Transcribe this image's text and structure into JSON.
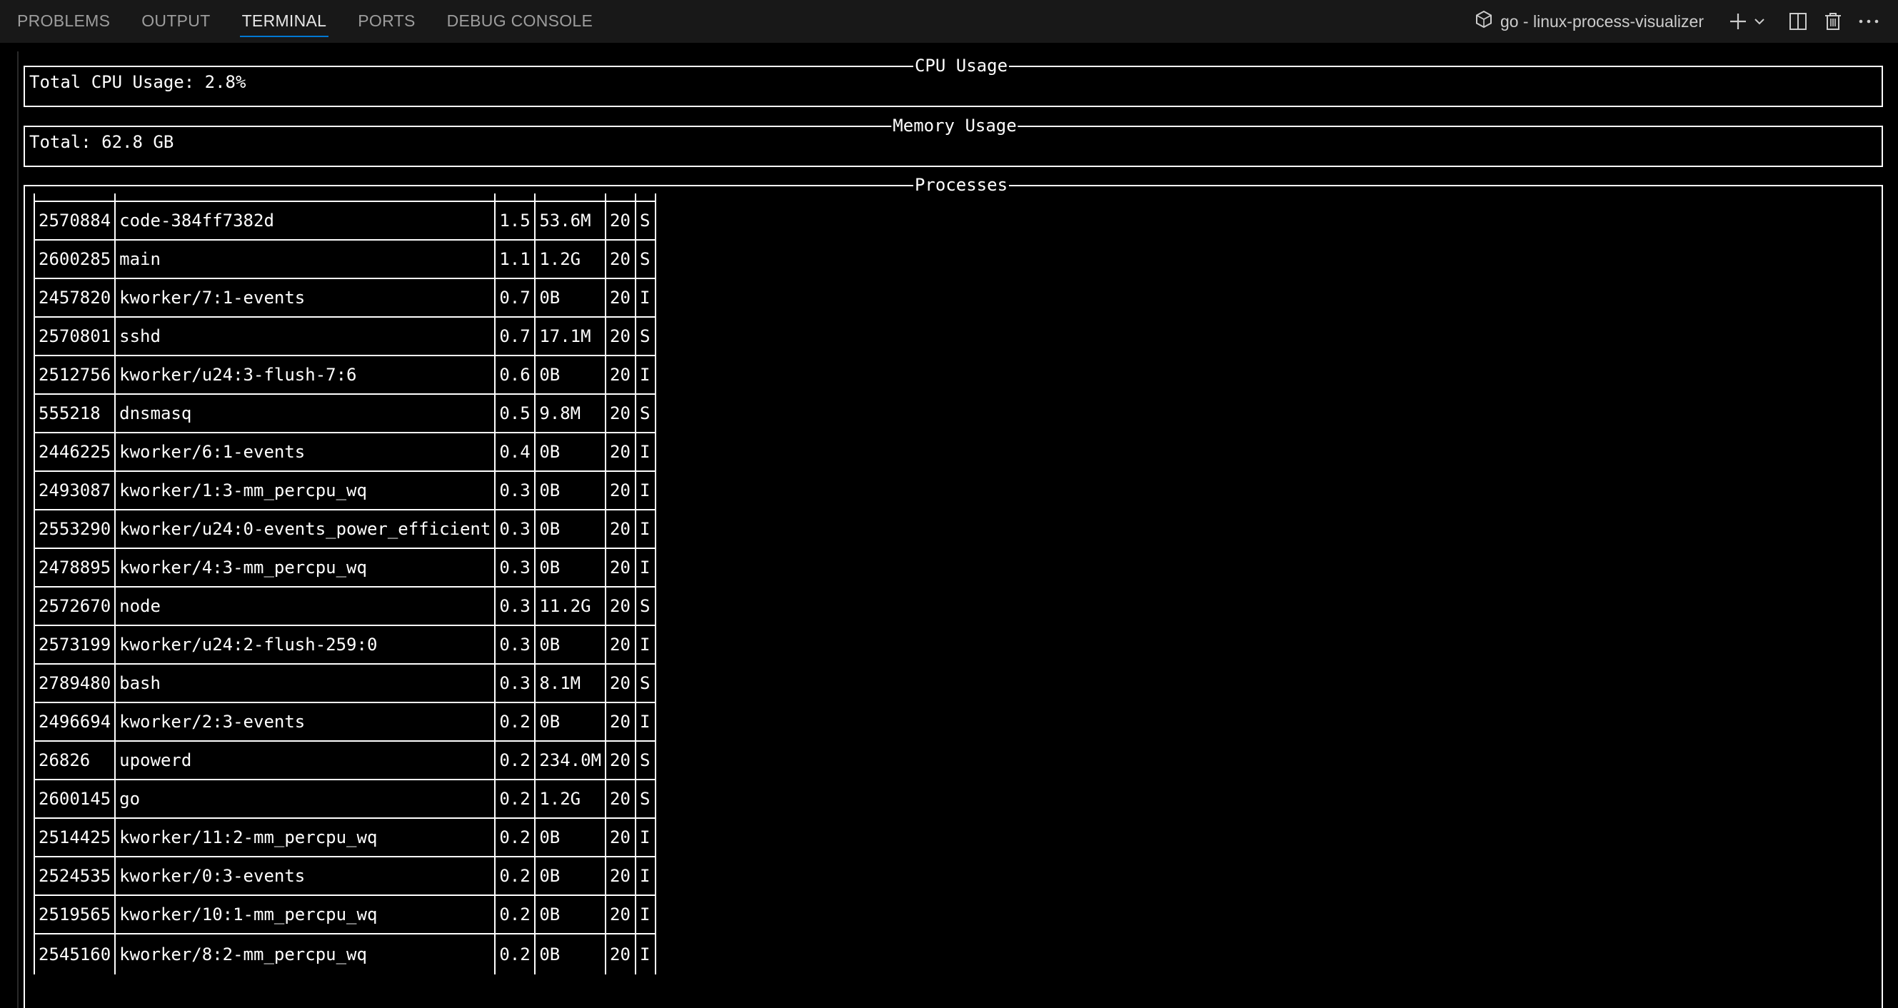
{
  "panel": {
    "tabs": [
      {
        "label": "PROBLEMS",
        "active": false
      },
      {
        "label": "OUTPUT",
        "active": false
      },
      {
        "label": "TERMINAL",
        "active": true
      },
      {
        "label": "PORTS",
        "active": false
      },
      {
        "label": "DEBUG CONSOLE",
        "active": false
      }
    ],
    "terminal_name": "go - linux-process-visualizer",
    "icons": [
      "terminal-icon",
      "plus-icon",
      "chevron-down-icon",
      "split-icon",
      "trash-icon",
      "more-icon"
    ],
    "accent_color": "#0078d4"
  },
  "cpu": {
    "title": "CPU Usage",
    "text": "Total CPU Usage: 2.8%"
  },
  "memory": {
    "title": "Memory Usage",
    "text": "Total: 62.8 GB"
  },
  "processes": {
    "title": "Processes",
    "rows": [
      [
        "2570884",
        "code-384ff7382d",
        "1.5",
        "53.6M",
        "20",
        "S"
      ],
      [
        "2600285",
        "main",
        "1.1",
        "1.2G",
        "20",
        "S"
      ],
      [
        "2457820",
        "kworker/7:1-events",
        "0.7",
        "0B",
        "20",
        "I"
      ],
      [
        "2570801",
        "sshd",
        "0.7",
        "17.1M",
        "20",
        "S"
      ],
      [
        "2512756",
        "kworker/u24:3-flush-7:6",
        "0.6",
        "0B",
        "20",
        "I"
      ],
      [
        "555218",
        "dnsmasq",
        "0.5",
        "9.8M",
        "20",
        "S"
      ],
      [
        "2446225",
        "kworker/6:1-events",
        "0.4",
        "0B",
        "20",
        "I"
      ],
      [
        "2493087",
        "kworker/1:3-mm_percpu_wq",
        "0.3",
        "0B",
        "20",
        "I"
      ],
      [
        "2553290",
        "kworker/u24:0-events_power_efficient",
        "0.3",
        "0B",
        "20",
        "I"
      ],
      [
        "2478895",
        "kworker/4:3-mm_percpu_wq",
        "0.3",
        "0B",
        "20",
        "I"
      ],
      [
        "2572670",
        "node",
        "0.3",
        "11.2G",
        "20",
        "S"
      ],
      [
        "2573199",
        "kworker/u24:2-flush-259:0",
        "0.3",
        "0B",
        "20",
        "I"
      ],
      [
        "2789480",
        "bash",
        "0.3",
        "8.1M",
        "20",
        "S"
      ],
      [
        "2496694",
        "kworker/2:3-events",
        "0.2",
        "0B",
        "20",
        "I"
      ],
      [
        "26826",
        "upowerd",
        "0.2",
        "234.0M",
        "20",
        "S"
      ],
      [
        "2600145",
        "go",
        "0.2",
        "1.2G",
        "20",
        "S"
      ],
      [
        "2514425",
        "kworker/11:2-mm_percpu_wq",
        "0.2",
        "0B",
        "20",
        "I"
      ],
      [
        "2524535",
        "kworker/0:3-events",
        "0.2",
        "0B",
        "20",
        "I"
      ],
      [
        "2519565",
        "kworker/10:1-mm_percpu_wq",
        "0.2",
        "0B",
        "20",
        "I"
      ],
      [
        "2545160",
        "kworker/8:2-mm_percpu_wq",
        "0.2",
        "0B",
        "20",
        "I"
      ]
    ]
  }
}
